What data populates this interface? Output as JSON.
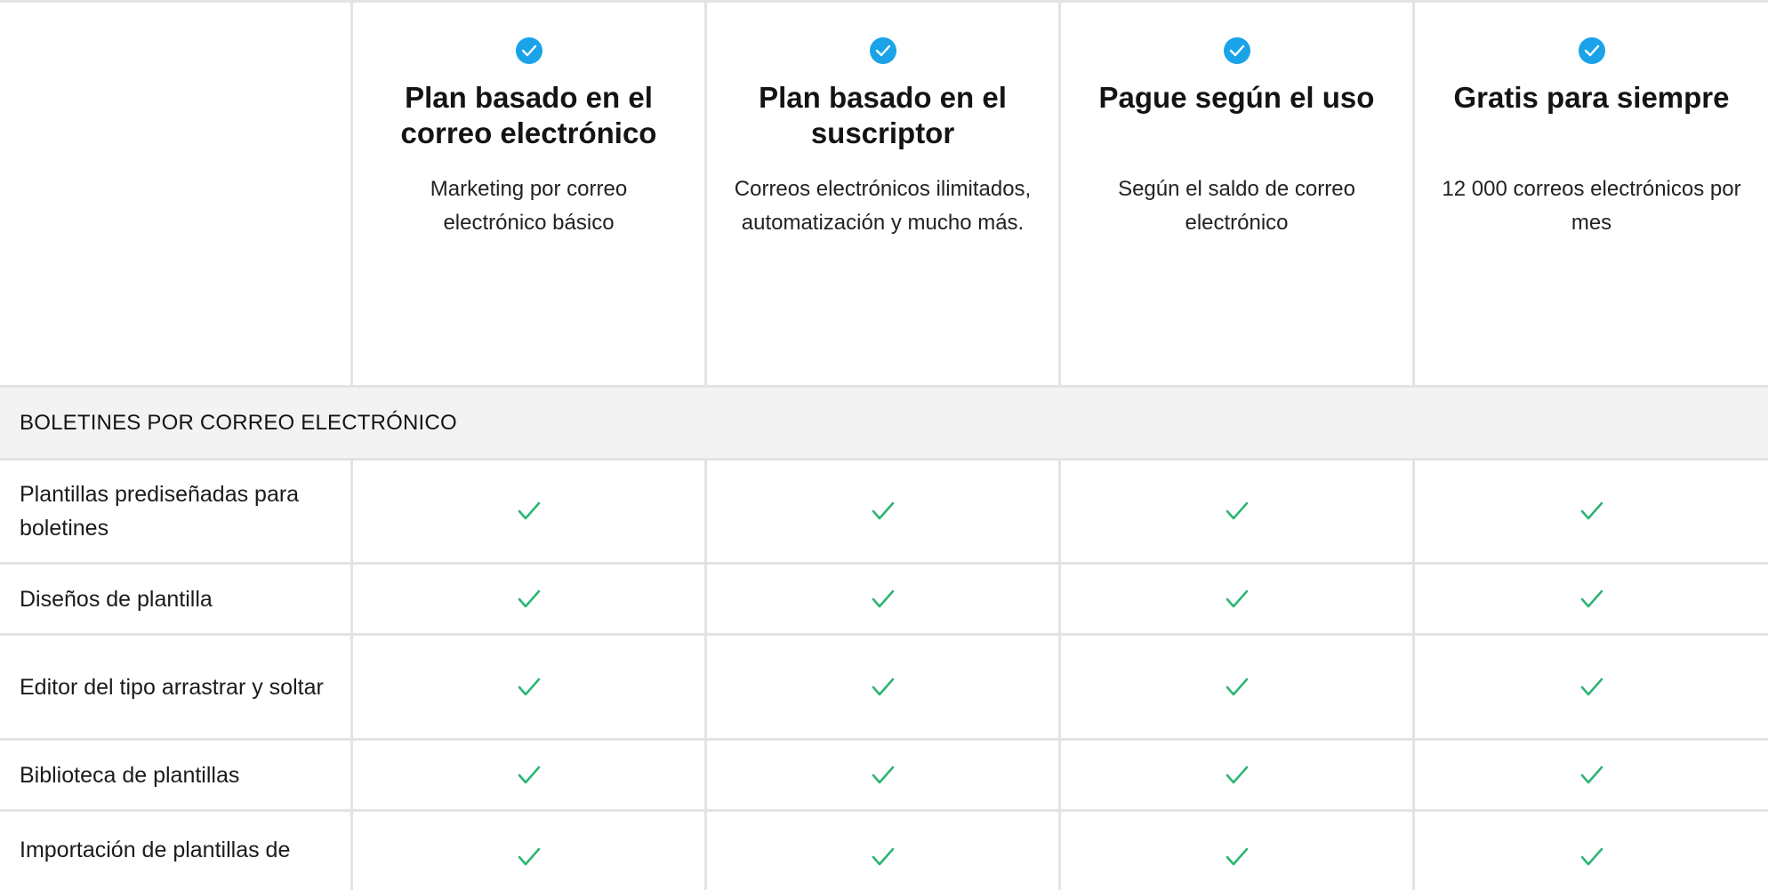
{
  "plans": [
    {
      "title": "Plan basado en el correo electrónico",
      "description": "Marketing por correo electrónico básico"
    },
    {
      "title": "Plan basado en el suscriptor",
      "description": "Correos electrónicos ilimitados, automatización y mucho más."
    },
    {
      "title": "Pague según el uso",
      "description": "Según el saldo de correo electrónico"
    },
    {
      "title": "Gratis para siempre",
      "description": "12 000 correos electrónicos por mes"
    }
  ],
  "section": {
    "title": "BOLETINES POR CORREO ELECTRÓNICO"
  },
  "features": [
    {
      "label": "Plantillas prediseñadas para boletines",
      "included": [
        true,
        true,
        true,
        true
      ]
    },
    {
      "label": "Diseños de plantilla",
      "included": [
        true,
        true,
        true,
        true
      ]
    },
    {
      "label": "Editor del tipo arrastrar y soltar",
      "included": [
        true,
        true,
        true,
        true
      ]
    },
    {
      "label": "Biblioteca de plantillas",
      "included": [
        true,
        true,
        true,
        true
      ]
    },
    {
      "label": "Importación de plantillas de",
      "included": [
        true,
        true,
        true,
        true
      ]
    }
  ],
  "colors": {
    "badge": "#1aa3e8",
    "check": "#2bb673",
    "divider": "#e3e3e3",
    "section_bg": "#f3f3f3"
  },
  "icons": {
    "plan_badge": "check-circle-icon",
    "feature_check": "checkmark-icon"
  }
}
